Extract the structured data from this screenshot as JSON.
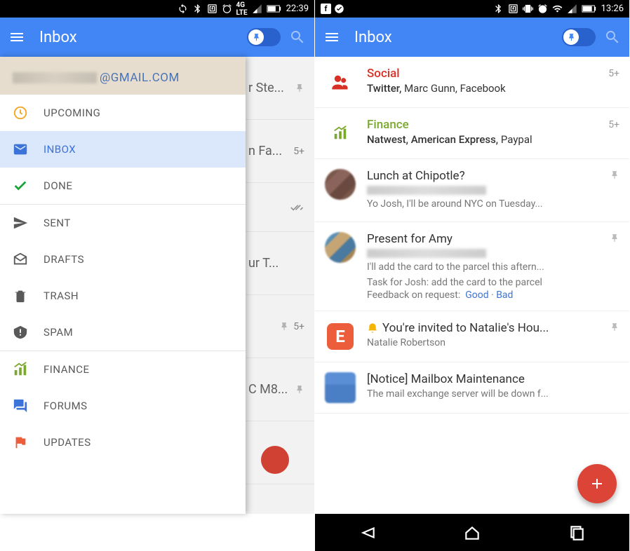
{
  "phone1": {
    "status": {
      "time": "22:39"
    },
    "app_title": "Inbox",
    "account_suffix": "@GMAIL.COM",
    "drawer": [
      {
        "icon": "clock",
        "label": "UPCOMING",
        "color": "#f4a623"
      },
      {
        "icon": "mail",
        "label": "INBOX",
        "color": "#3b73d9",
        "active": true
      },
      {
        "icon": "check",
        "label": "DONE",
        "color": "#1aa33a"
      },
      {
        "divider": true
      },
      {
        "icon": "send",
        "label": "SENT",
        "color": "#595959"
      },
      {
        "icon": "draft",
        "label": "DRAFTS",
        "color": "#595959"
      },
      {
        "icon": "trash",
        "label": "TRASH",
        "color": "#595959"
      },
      {
        "icon": "spam",
        "label": "SPAM",
        "color": "#595959"
      },
      {
        "divider": true
      },
      {
        "icon": "finance",
        "label": "FINANCE",
        "color": "#7ba82e"
      },
      {
        "icon": "forums",
        "label": "FORUMS",
        "color": "#3b73d9"
      },
      {
        "icon": "flag",
        "label": "UPDATES",
        "color": "#eb5d3b"
      }
    ],
    "peek": [
      {
        "text": "r Ste...",
        "pin": true
      },
      {
        "text": "n Fa...",
        "count": "5+"
      },
      {
        "text": "",
        "done": true
      },
      {
        "text": "ur T..."
      },
      {
        "text": "",
        "pin": true,
        "count": "5+"
      },
      {
        "text": "C M8...",
        "pin": true
      }
    ]
  },
  "phone2": {
    "status": {
      "time": "13:26"
    },
    "app_title": "Inbox",
    "messages": [
      {
        "type": "bundle",
        "icon": "social",
        "title": "Social",
        "title_color": "red",
        "senders_html": "<b>Twitter,</b> Marc Gunn, Facebook",
        "count": "5+"
      },
      {
        "type": "bundle",
        "icon": "finance",
        "title": "Finance",
        "title_color": "green",
        "senders_html": "<b>Natwest, American Express,</b> Paypal",
        "count": "5+"
      },
      {
        "type": "email",
        "avatar": "pixelated",
        "title": "Lunch at Chipotle?",
        "sub_blur": true,
        "preview": "Yo Josh, I'll be around NYC on Tuesday...",
        "pin": true
      },
      {
        "type": "email",
        "avatar": "pixelated2",
        "title": "Present for Amy",
        "sub_blur": true,
        "preview": "I'll add the card to the parcel this aftern...",
        "task": "Task for Josh: add the card to the parcel",
        "feedback_prefix": "Feedback on request:",
        "feedback_good": "Good",
        "feedback_bad": "Bad",
        "pin": true
      },
      {
        "type": "email",
        "avatar": "event",
        "title": "You're invited to Natalie's Hou...",
        "reminder": true,
        "sender": "Natalie Robertson",
        "pin": true
      },
      {
        "type": "email",
        "avatar": "pixelated3",
        "title": "[Notice] Mailbox Maintenance",
        "preview": "The mail exchange server will be down f..."
      }
    ]
  }
}
